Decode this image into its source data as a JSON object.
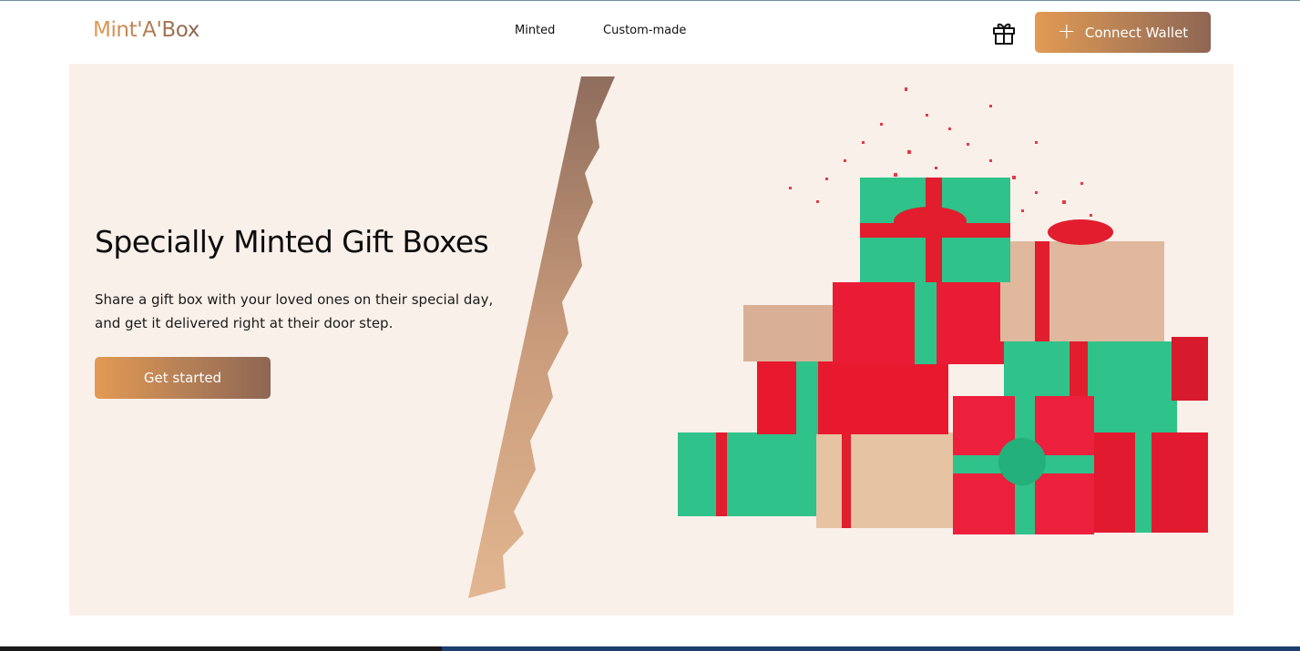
{
  "header": {
    "logo": "Mint'A'Box",
    "nav": [
      {
        "label": "Minted"
      },
      {
        "label": "Custom-made"
      }
    ],
    "connect_wallet_label": "Connect Wallet",
    "gift_icon": "gift-icon",
    "plus_icon": "plus-icon"
  },
  "hero": {
    "title": "Specially Minted Gift Boxes",
    "description": "Share a gift box with your loved ones on their special day, and get it delivered right at their door step.",
    "cta_label": "Get started"
  },
  "colors": {
    "accent_start": "#e39a54",
    "accent_end": "#8e6654",
    "hero_bg": "#f9f0e9"
  }
}
